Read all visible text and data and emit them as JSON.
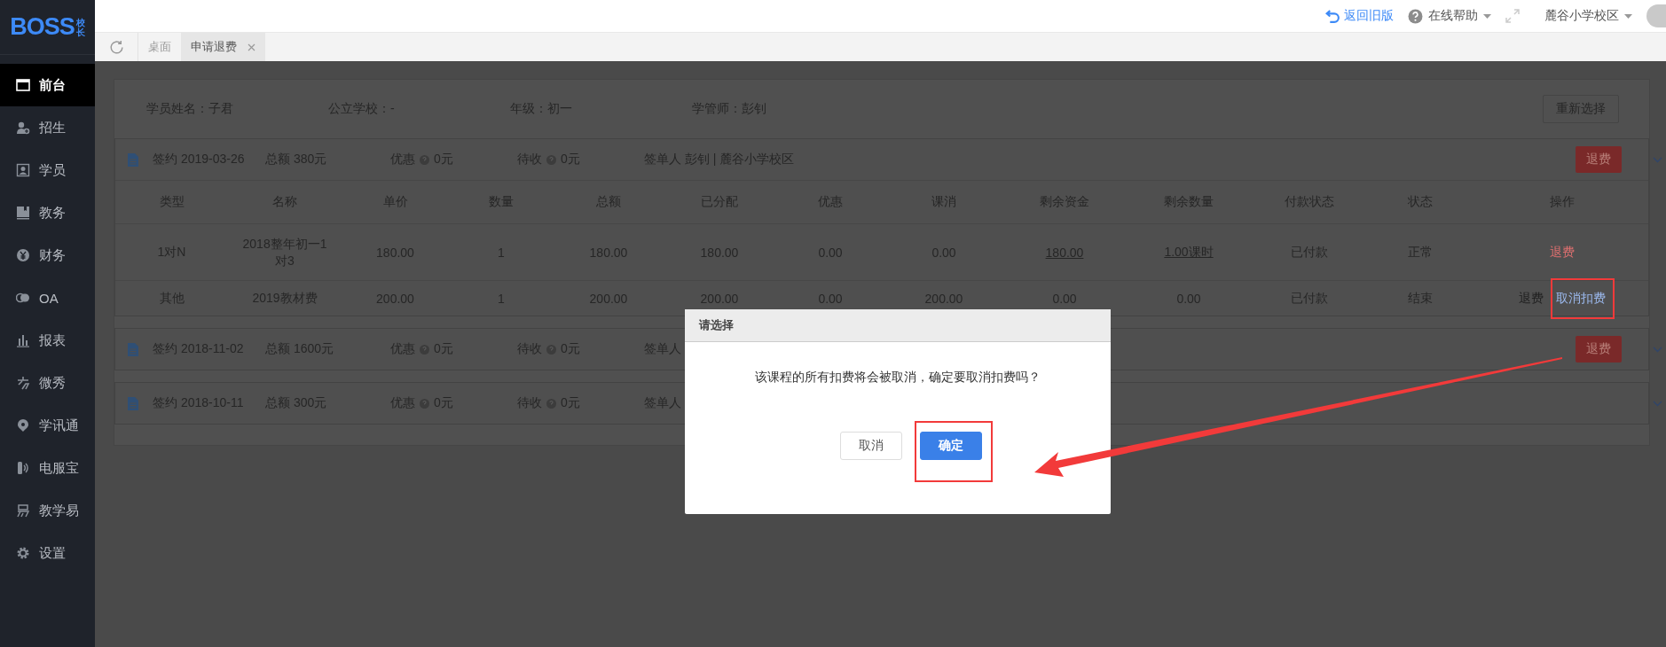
{
  "logo": {
    "text": "BOSS",
    "badge": "校长"
  },
  "sidebar": {
    "items": [
      {
        "label": "前台",
        "selected": true
      },
      {
        "label": "招生",
        "selected": false
      },
      {
        "label": "学员",
        "selected": false
      },
      {
        "label": "教务",
        "selected": false
      },
      {
        "label": "财务",
        "selected": false
      },
      {
        "label": "OA",
        "selected": false
      },
      {
        "label": "报表",
        "selected": false
      },
      {
        "label": "微秀",
        "selected": false
      },
      {
        "label": "学讯通",
        "selected": false
      },
      {
        "label": "电服宝",
        "selected": false
      },
      {
        "label": "教学易",
        "selected": false
      },
      {
        "label": "设置",
        "selected": false
      }
    ]
  },
  "topbar": {
    "back_link": "返回旧版",
    "help": "在线帮助",
    "campus": "麓谷小学校区"
  },
  "tabs": [
    {
      "label": "桌面",
      "selected": false,
      "closable": false
    },
    {
      "label": "申请退费",
      "selected": true,
      "closable": true
    }
  ],
  "student": {
    "fields": [
      "学员姓名：子君",
      "公立学校：-",
      "年级：初一",
      "学管师：彭钊"
    ],
    "reselect_button": "重新选择"
  },
  "contracts": [
    {
      "signed": "签约 2019-03-26",
      "total": "总额 380元",
      "discount_label": "优惠",
      "discount": "0元",
      "pending_label": "待收",
      "pending": "0元",
      "signer": "签单人 彭钊 | 麓谷小学校区",
      "refund_button": "退费",
      "table": {
        "columns": [
          "类型",
          "名称",
          "单价",
          "数量",
          "总额",
          "已分配",
          "优惠",
          "课消",
          "剩余资金",
          "剩余数量",
          "付款状态",
          "状态",
          "操作"
        ],
        "rows": [
          {
            "cells": [
              {
                "text": "1对N",
                "link": false
              },
              {
                "text": "2018整年初一1对3",
                "link": false
              },
              {
                "text": "180.00",
                "link": false
              },
              {
                "text": "1",
                "link": false
              },
              {
                "text": "180.00",
                "link": false
              },
              {
                "text": "180.00",
                "link": false
              },
              {
                "text": "0.00",
                "link": false
              },
              {
                "text": "0.00",
                "link": false
              },
              {
                "text": "180.00",
                "link": true
              },
              {
                "text": "1.00课时",
                "link": true
              },
              {
                "text": "已付款",
                "link": false
              },
              {
                "text": "正常",
                "link": false
              }
            ],
            "actions": [
              {
                "label": "退费",
                "kind": "refund",
                "disabled": false,
                "highlighted": false
              }
            ]
          },
          {
            "cells": [
              {
                "text": "其他",
                "link": false
              },
              {
                "text": "2019教材费",
                "link": false
              },
              {
                "text": "200.00",
                "link": false
              },
              {
                "text": "1",
                "link": false
              },
              {
                "text": "200.00",
                "link": false
              },
              {
                "text": "200.00",
                "link": false
              },
              {
                "text": "0.00",
                "link": false
              },
              {
                "text": "200.00",
                "link": false
              },
              {
                "text": "0.00",
                "link": false
              },
              {
                "text": "0.00",
                "link": false
              },
              {
                "text": "已付款",
                "link": false
              },
              {
                "text": "结束",
                "link": false
              }
            ],
            "actions": [
              {
                "label": "退费",
                "kind": "refund",
                "disabled": true,
                "highlighted": false
              },
              {
                "label": "取消扣费",
                "kind": "cancel",
                "disabled": false,
                "highlighted": true
              }
            ]
          }
        ]
      }
    },
    {
      "signed": "签约 2018-11-02",
      "total": "总额 1600元",
      "discount_label": "优惠",
      "discount": "0元",
      "pending_label": "待收",
      "pending": "0元",
      "signer": "签单人",
      "refund_button": "退费"
    },
    {
      "signed": "签约 2018-10-11",
      "total": "总额 300元",
      "discount_label": "优惠",
      "discount": "0元",
      "pending_label": "待收",
      "pending": "0元",
      "signer": "签单人"
    }
  ],
  "dialog": {
    "title": "请选择",
    "message": "该课程的所有扣费将会被取消，确定要取消扣费吗？",
    "buttons": [
      {
        "label": "取消",
        "kind": "default",
        "highlighted": false
      },
      {
        "label": "确定",
        "kind": "primary",
        "highlighted": true
      }
    ]
  },
  "annotation": {
    "arrow": true
  }
}
